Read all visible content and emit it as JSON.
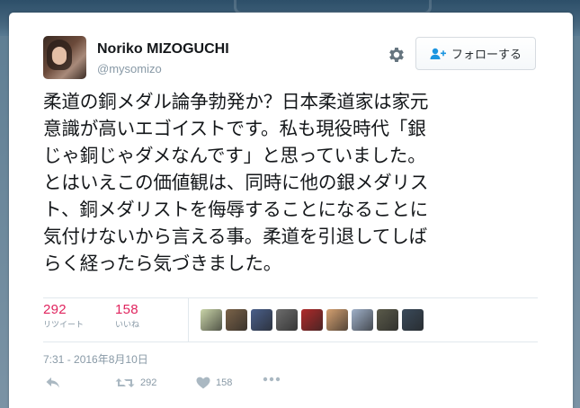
{
  "tweet": {
    "author": {
      "name": "Noriko MIZOGUCHI",
      "handle": "@mysomizo"
    },
    "follow_label": "フォローする",
    "text": "柔道の銅メダル論争勃発か？日本柔道家は家元\n意識が高いエゴイストです。私も現役時代「銀\nじゃ銅じゃダメなんです」と思っていました。\nとはいえこの価値観は、同時に他の銀メダリス\nト、銅メダリストを侮辱することになることに\n気付けないから言える事。柔道を引退してしば\nらく経ったら気づきました。",
    "stats": {
      "retweets_count": "292",
      "retweets_label": "リツイート",
      "likes_count": "158",
      "likes_label": "いいね"
    },
    "timestamp": "7:31 - 2016年8月10日",
    "actions": {
      "retweet_count": "292",
      "like_count": "158"
    },
    "liker_avatars": [
      {
        "color": "#c9d4a8"
      },
      {
        "color": "#7a6248"
      },
      {
        "color": "#4a5f8a"
      },
      {
        "color": "#6c6c6c"
      },
      {
        "color": "#b02a2a"
      },
      {
        "color": "#d4a070"
      },
      {
        "color": "#9fb0c8"
      },
      {
        "color": "#5a5a4a"
      },
      {
        "color": "#3a4a5a"
      }
    ]
  },
  "colors": {
    "accent_pink": "#e0245e",
    "muted_text": "#8899a6"
  }
}
